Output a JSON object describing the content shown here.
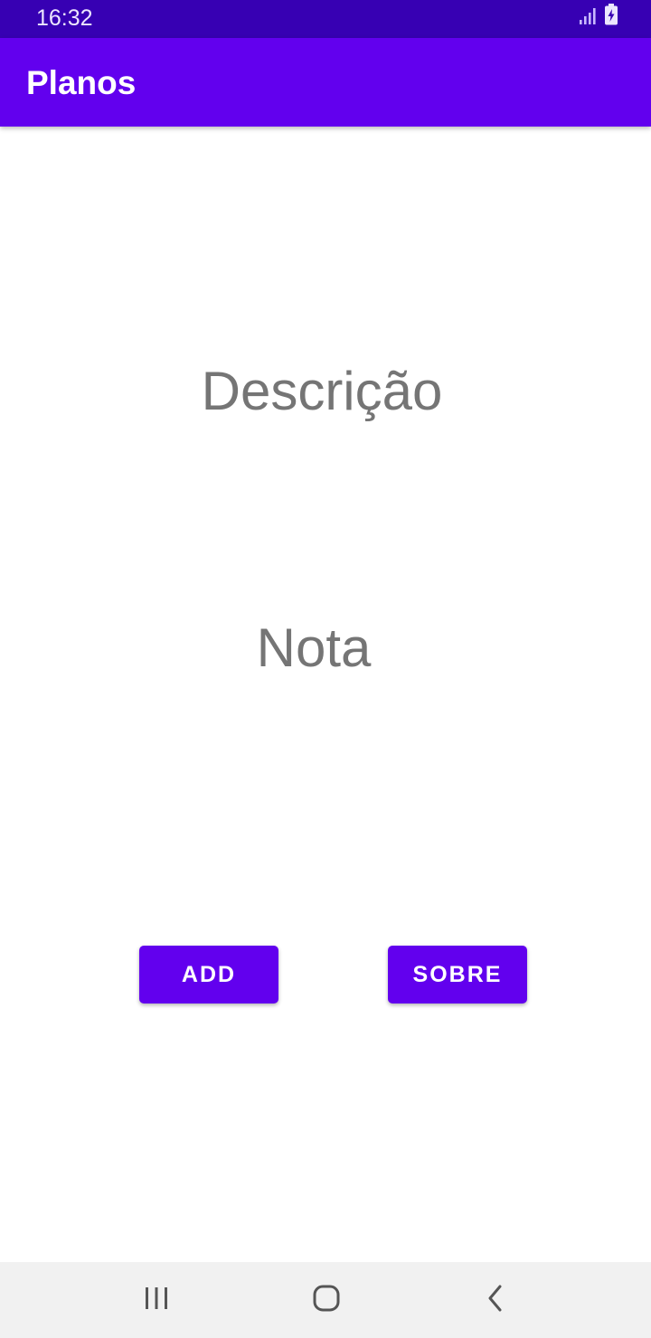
{
  "status_bar": {
    "time": "16:32",
    "icons": [
      "signal-icon",
      "battery-charging-icon"
    ]
  },
  "app_bar": {
    "title": "Planos"
  },
  "main": {
    "description_label": "Descrição",
    "note_label": "Nota",
    "add_button": "ADD",
    "about_button": "SOBRE"
  },
  "nav_bar": {
    "icons": [
      "recents-icon",
      "home-icon",
      "back-icon"
    ]
  },
  "colors": {
    "primary": "#6200ee",
    "primary_dark": "#3700b3",
    "text_secondary": "#757575",
    "nav_background": "#f1f1f1"
  }
}
